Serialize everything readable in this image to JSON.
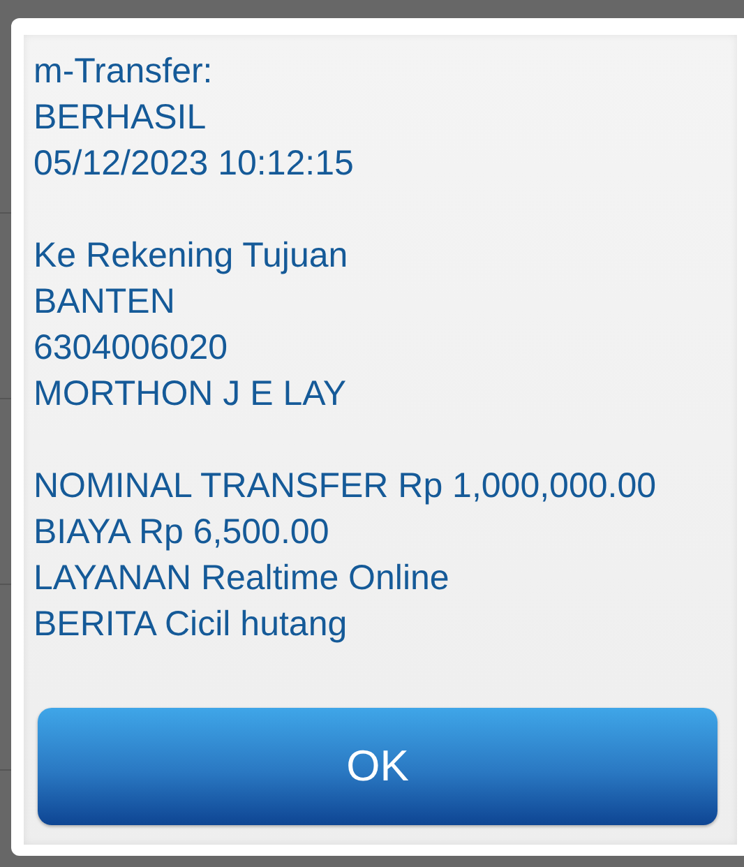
{
  "message": {
    "groups": [
      [
        "m-Transfer:",
        "BERHASIL",
        "05/12/2023 10:12:15"
      ],
      [
        "Ke Rekening Tujuan",
        "BANTEN",
        "6304006020",
        "MORTHON J E LAY"
      ],
      [
        "NOMINAL TRANSFER Rp 1,000,000.00",
        "BIAYA Rp 6,500.00",
        "LAYANAN Realtime Online",
        "BERITA Cicil hutang"
      ]
    ]
  },
  "buttons": [
    {
      "label": "OK"
    }
  ]
}
